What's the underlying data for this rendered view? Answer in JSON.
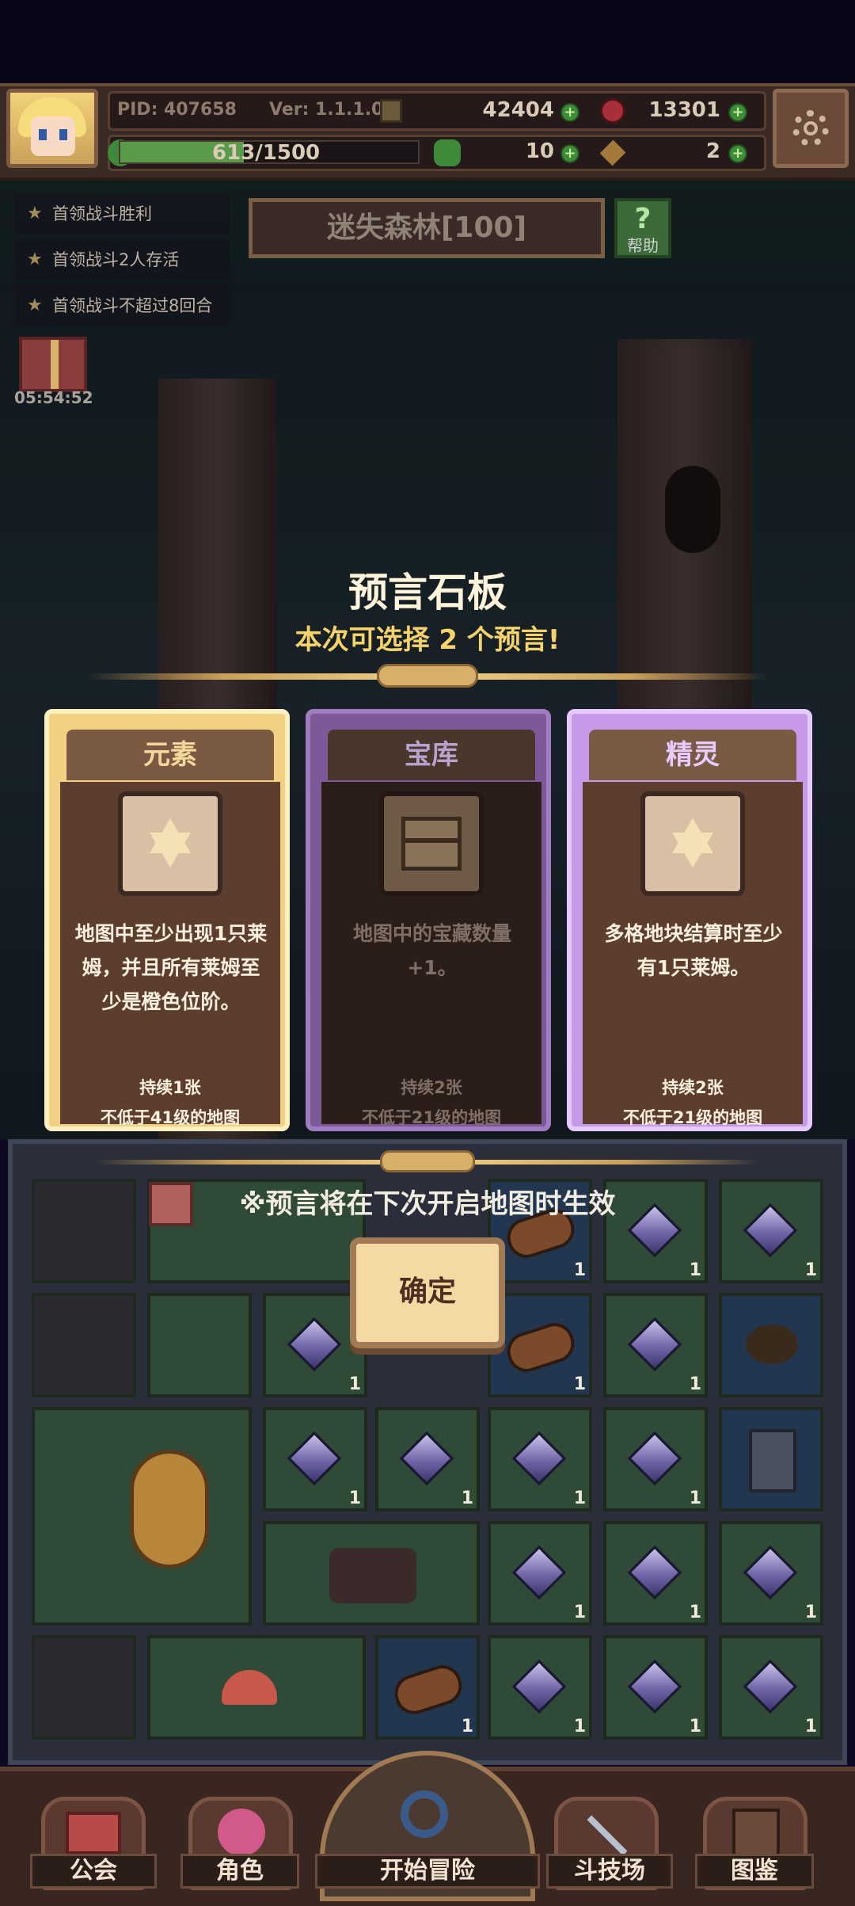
{
  "header": {
    "pid": "PID: 407658",
    "version": "Ver: 1.1.1.0",
    "coins": "42404",
    "gems": "13301",
    "exp": "613/1500",
    "clover": "10",
    "key": "2",
    "plus": "+"
  },
  "quests": [
    "首领战斗胜利",
    "首领战斗2人存活",
    "首领战斗不超过8回合"
  ],
  "map": {
    "title": "迷失森林[100]",
    "help": "帮助",
    "help_q": "?",
    "timer": "05:54:52"
  },
  "modal": {
    "title": "预言石板",
    "subtitle": "本次可选择 2 个预言!",
    "cards": [
      {
        "name": "元素",
        "desc": "地图中至少出现1只莱姆，并且所有莱姆至少是橙色位阶。",
        "duration": "持续1张",
        "level": "不低于41级的地图",
        "icon": "hexagram-icon"
      },
      {
        "name": "宝库",
        "desc": "地图中的宝藏数量+1。",
        "duration": "持续2张",
        "level": "不低于21级的地图",
        "icon": "treasure-chest-icon"
      },
      {
        "name": "精灵",
        "desc": "多格地块结算时至少有1只莱姆。",
        "duration": "持续2张",
        "level": "不低于21级的地图",
        "icon": "hexagram-icon"
      }
    ],
    "notice": "※预言将在下次开启地图时生效",
    "confirm": "确定"
  },
  "grid_count": "1",
  "nav": {
    "guild": "公会",
    "character": "角色",
    "start": "开始冒险",
    "arena": "斗技场",
    "codex": "图鉴"
  }
}
